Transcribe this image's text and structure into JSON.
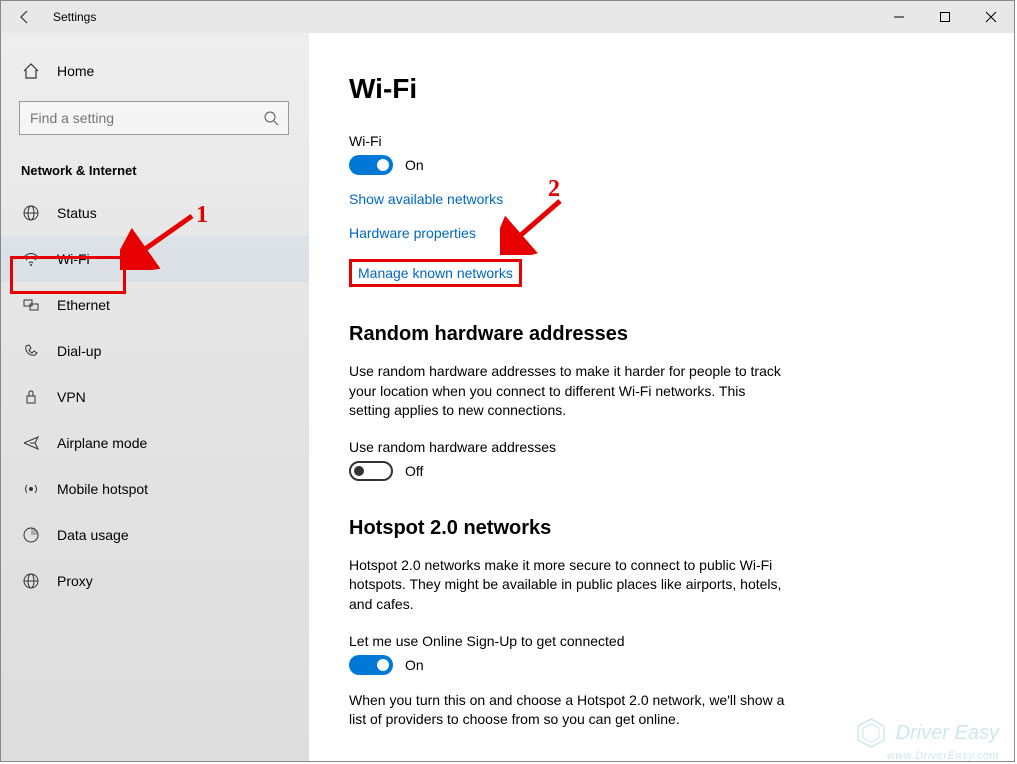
{
  "window": {
    "title": "Settings"
  },
  "sidebar": {
    "home": "Home",
    "search_placeholder": "Find a setting",
    "category": "Network & Internet",
    "items": [
      {
        "label": "Status"
      },
      {
        "label": "Wi-Fi"
      },
      {
        "label": "Ethernet"
      },
      {
        "label": "Dial-up"
      },
      {
        "label": "VPN"
      },
      {
        "label": "Airplane mode"
      },
      {
        "label": "Mobile hotspot"
      },
      {
        "label": "Data usage"
      },
      {
        "label": "Proxy"
      }
    ]
  },
  "main": {
    "title": "Wi-Fi",
    "wifi_label": "Wi-Fi",
    "wifi_state": "On",
    "link_available": "Show available networks",
    "link_hardware": "Hardware properties",
    "link_manage": "Manage known networks",
    "random_title": "Random hardware addresses",
    "random_desc": "Use random hardware addresses to make it harder for people to track your location when you connect to different Wi-Fi networks. This setting applies to new connections.",
    "random_toggle_label": "Use random hardware addresses",
    "random_state": "Off",
    "hotspot_title": "Hotspot 2.0 networks",
    "hotspot_desc": "Hotspot 2.0 networks make it more secure to connect to public Wi-Fi hotspots. They might be available in public places like airports, hotels, and cafes.",
    "hotspot_toggle_label": "Let me use Online Sign-Up to get connected",
    "hotspot_state": "On",
    "hotspot_footer": "When you turn this on and choose a Hotspot 2.0 network, we'll show a list of providers to choose from so you can get online."
  },
  "annotations": {
    "num1": "1",
    "num2": "2"
  },
  "watermark": {
    "brand": "Driver Easy",
    "url": "www.DriverEasy.com"
  }
}
